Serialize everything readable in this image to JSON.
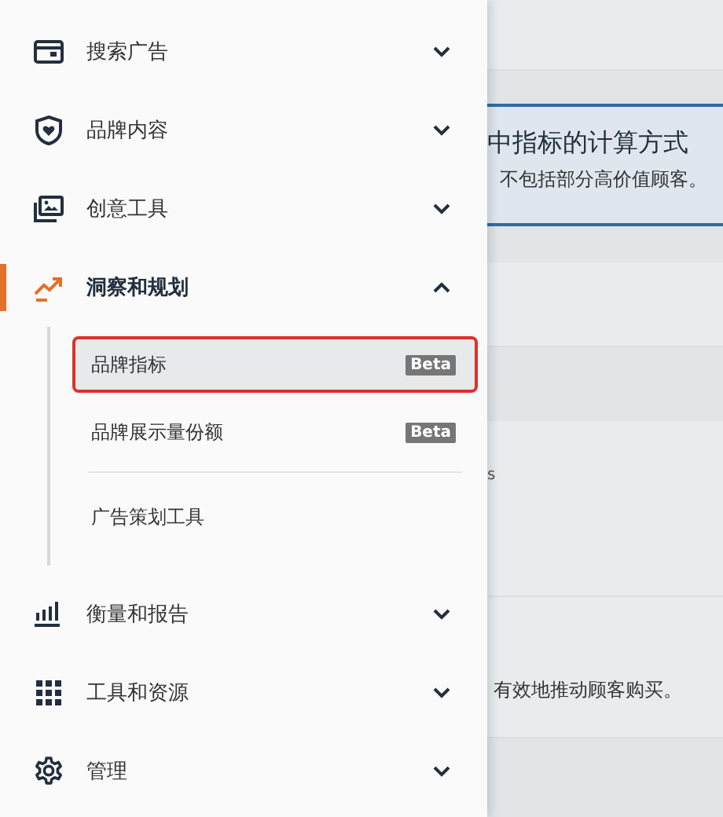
{
  "sidebar": {
    "items": [
      {
        "label": "搜索广告",
        "expanded": false
      },
      {
        "label": "品牌内容",
        "expanded": false
      },
      {
        "label": "创意工具",
        "expanded": false
      },
      {
        "label": "洞察和规划",
        "expanded": true,
        "children": [
          {
            "label": "品牌指标",
            "badge": "Beta",
            "selected": true
          },
          {
            "label": "品牌展示量份额",
            "badge": "Beta",
            "selected": false
          },
          {
            "label": "广告策划工具",
            "selected": false
          }
        ]
      },
      {
        "label": "衡量和报告",
        "expanded": false
      },
      {
        "label": "工具和资源",
        "expanded": false
      },
      {
        "label": "管理",
        "expanded": false
      }
    ]
  },
  "background_page": {
    "notice_title": "中指标的计算方式",
    "notice_text": "不包括部分高价值顾客。",
    "row_text": "s",
    "footer_text": "有效地推动顾客购买。"
  }
}
